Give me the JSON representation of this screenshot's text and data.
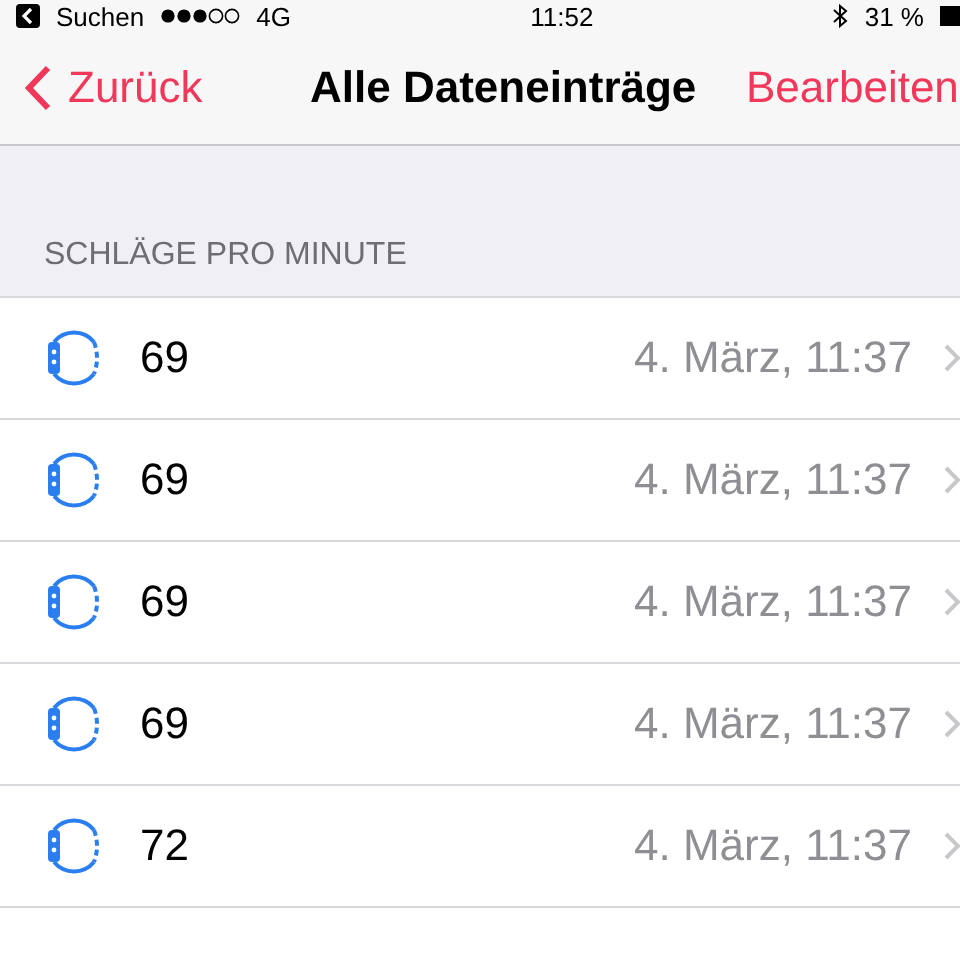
{
  "status_bar": {
    "carrier": "Suchen",
    "network": "4G",
    "time": "11:52",
    "battery": "31 %"
  },
  "nav": {
    "back": "Zurück",
    "title": "Alle Dateneinträge",
    "action": "Bearbeiten"
  },
  "section": {
    "header": "SCHLÄGE PRO MINUTE"
  },
  "entries": [
    {
      "value": "69",
      "date": "4. März, 11:37"
    },
    {
      "value": "69",
      "date": "4. März, 11:37"
    },
    {
      "value": "69",
      "date": "4. März, 11:37"
    },
    {
      "value": "69",
      "date": "4. März, 11:37"
    },
    {
      "value": "72",
      "date": "4. März, 11:37"
    }
  ]
}
